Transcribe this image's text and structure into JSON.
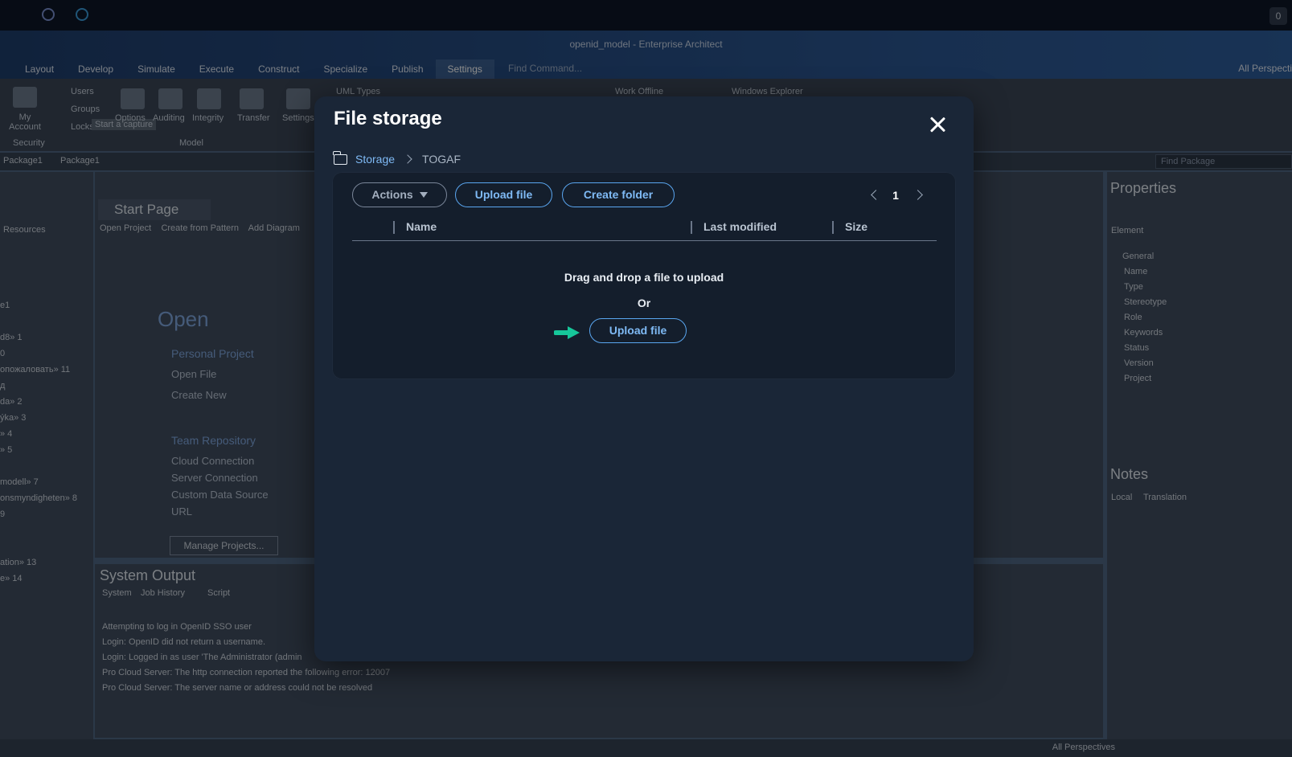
{
  "window": {
    "title": "openid_model - Enterprise Architect",
    "badge": "0"
  },
  "menu": {
    "items": [
      "Layout",
      "Develop",
      "Simulate",
      "Execute",
      "Construct",
      "Specialize",
      "Publish",
      "Settings"
    ],
    "active": "Settings",
    "find_command": "Find Command...",
    "perspectives": "All Perspecti"
  },
  "ribbon": {
    "my_account": "My Account",
    "users": "Users",
    "groups": "Groups",
    "locks": "Locks",
    "tooltip": "Start a capture",
    "options": "Options",
    "auditing": "Auditing",
    "integrity": "Integrity",
    "transfer": "Transfer",
    "settings": "Settings",
    "uml_types": "UML Types",
    "work_offline": "Work Offline",
    "windows_explorer": "Windows Explorer",
    "group_security": "Security",
    "group_model": "Model"
  },
  "breadcrumb_bar": {
    "item1": "Package1",
    "item2": "Package1",
    "find_package": "Find Package"
  },
  "left_pane": {
    "resources": "Resources",
    "rows": [
      "e1",
      "d8» 1",
      "0",
      "опожаловать» 11",
      "д",
      "da» 2",
      "ýka» 3",
      "» 4",
      "» 5",
      "modell» 7",
      "onsmyndigheten» 8",
      "9",
      "ation» 13",
      "e» 14"
    ]
  },
  "start_page": {
    "tab": "Start Page",
    "subtabs": [
      "Open Project",
      "Create from Pattern",
      "Add Diagram"
    ],
    "open_heading": "Open",
    "personal_project": "Personal Project",
    "open_file": "Open File",
    "create_new": "Create New",
    "team_repository": "Team Repository",
    "cloud_connection": "Cloud Connection",
    "server_connection": "Server Connection",
    "custom_data_source": "Custom Data Source",
    "url": "URL",
    "manage_projects": "Manage Projects..."
  },
  "system_output": {
    "title": "System Output",
    "tabs": [
      "System",
      "Job History",
      "Script"
    ],
    "lines": [
      "Attempting to log in OpenID SSO user",
      "Login: OpenID did not return a username.",
      "Login: Logged in as user 'The Administrator (admin",
      "Pro Cloud Server: The http connection reported the following error: 12007",
      "Pro Cloud Server: The server name or address could not be resolved"
    ]
  },
  "properties": {
    "title": "Properties",
    "tab": "Element",
    "general": "General",
    "name_placeholder": "Name",
    "fields": [
      "Type",
      "Stereotype",
      "Role",
      "Keywords",
      "Status",
      "Version"
    ],
    "project": "Project"
  },
  "notes": {
    "title": "Notes",
    "tabs": [
      "Local",
      "Translation"
    ]
  },
  "statusbar": {
    "perspectives": "All Perspectives"
  },
  "dialog": {
    "title": "File storage",
    "breadcrumb": {
      "root": "Storage",
      "current": "TOGAF"
    },
    "actions_label": "Actions",
    "upload_label": "Upload file",
    "create_folder_label": "Create folder",
    "page": "1",
    "columns": {
      "name": "Name",
      "last_modified": "Last modified",
      "size": "Size"
    },
    "drop_text": "Drag and drop a file to upload",
    "or_text": "Or",
    "upload_label_2": "Upload file",
    "arrow_color": "#16c79a",
    "accent_color": "#5aa6f0"
  }
}
